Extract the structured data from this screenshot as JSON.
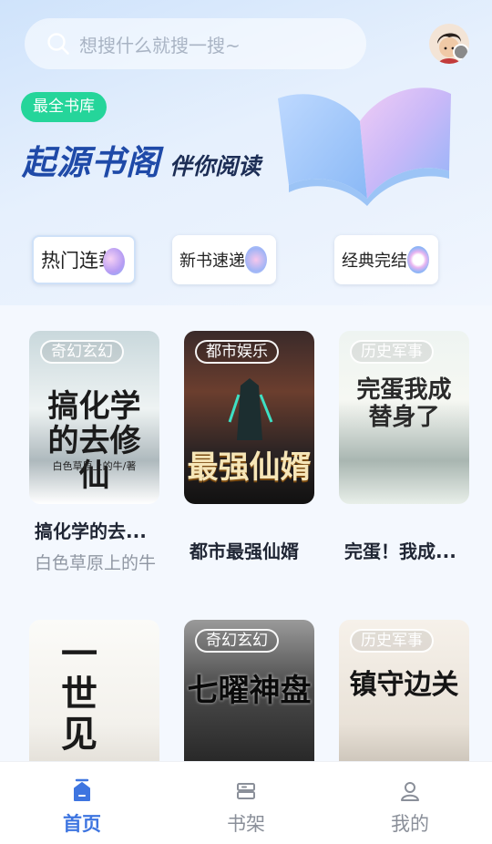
{
  "search": {
    "placeholder": "想搜什么就搜一搜~",
    "icon": "search-icon"
  },
  "hero": {
    "badge": "最全书库",
    "slogan_main": "起源书阁",
    "slogan_sub": "伴你阅读"
  },
  "categories": [
    {
      "label": "热门连载",
      "active": true
    },
    {
      "label": "新书速递",
      "active": false
    },
    {
      "label": "经典完结",
      "active": false
    }
  ],
  "books": [
    {
      "genre": "奇幻玄幻",
      "cover_text": "搞化学的去修仙",
      "cover_author": "白色草原上的牛/著",
      "title": "搞化学的去...",
      "author": "白色草原上的牛"
    },
    {
      "genre": "都市娱乐",
      "cover_text": "最强仙婿",
      "cover_author": "",
      "title": "都市最强仙婿",
      "author": ""
    },
    {
      "genre": "历史军事",
      "cover_text": "完蛋我成替身了",
      "cover_author": "",
      "title": "完蛋！我成...",
      "author": ""
    },
    {
      "genre": "",
      "cover_text": "一世见",
      "cover_author": "",
      "title": "",
      "author": ""
    },
    {
      "genre": "奇幻玄幻",
      "cover_text": "七曜神盘",
      "cover_author": "",
      "title": "",
      "author": ""
    },
    {
      "genre": "历史军事",
      "cover_text": "镇守边关",
      "cover_author": "",
      "title": "",
      "author": ""
    }
  ],
  "tabbar": [
    {
      "label": "首页",
      "icon": "home-icon",
      "active": true
    },
    {
      "label": "书架",
      "icon": "bookshelf-icon",
      "active": false
    },
    {
      "label": "我的",
      "icon": "profile-icon",
      "active": false
    }
  ],
  "colors": {
    "accent": "#3e75e0",
    "badge": "#25d59a",
    "slogan": "#1f4aa8"
  }
}
